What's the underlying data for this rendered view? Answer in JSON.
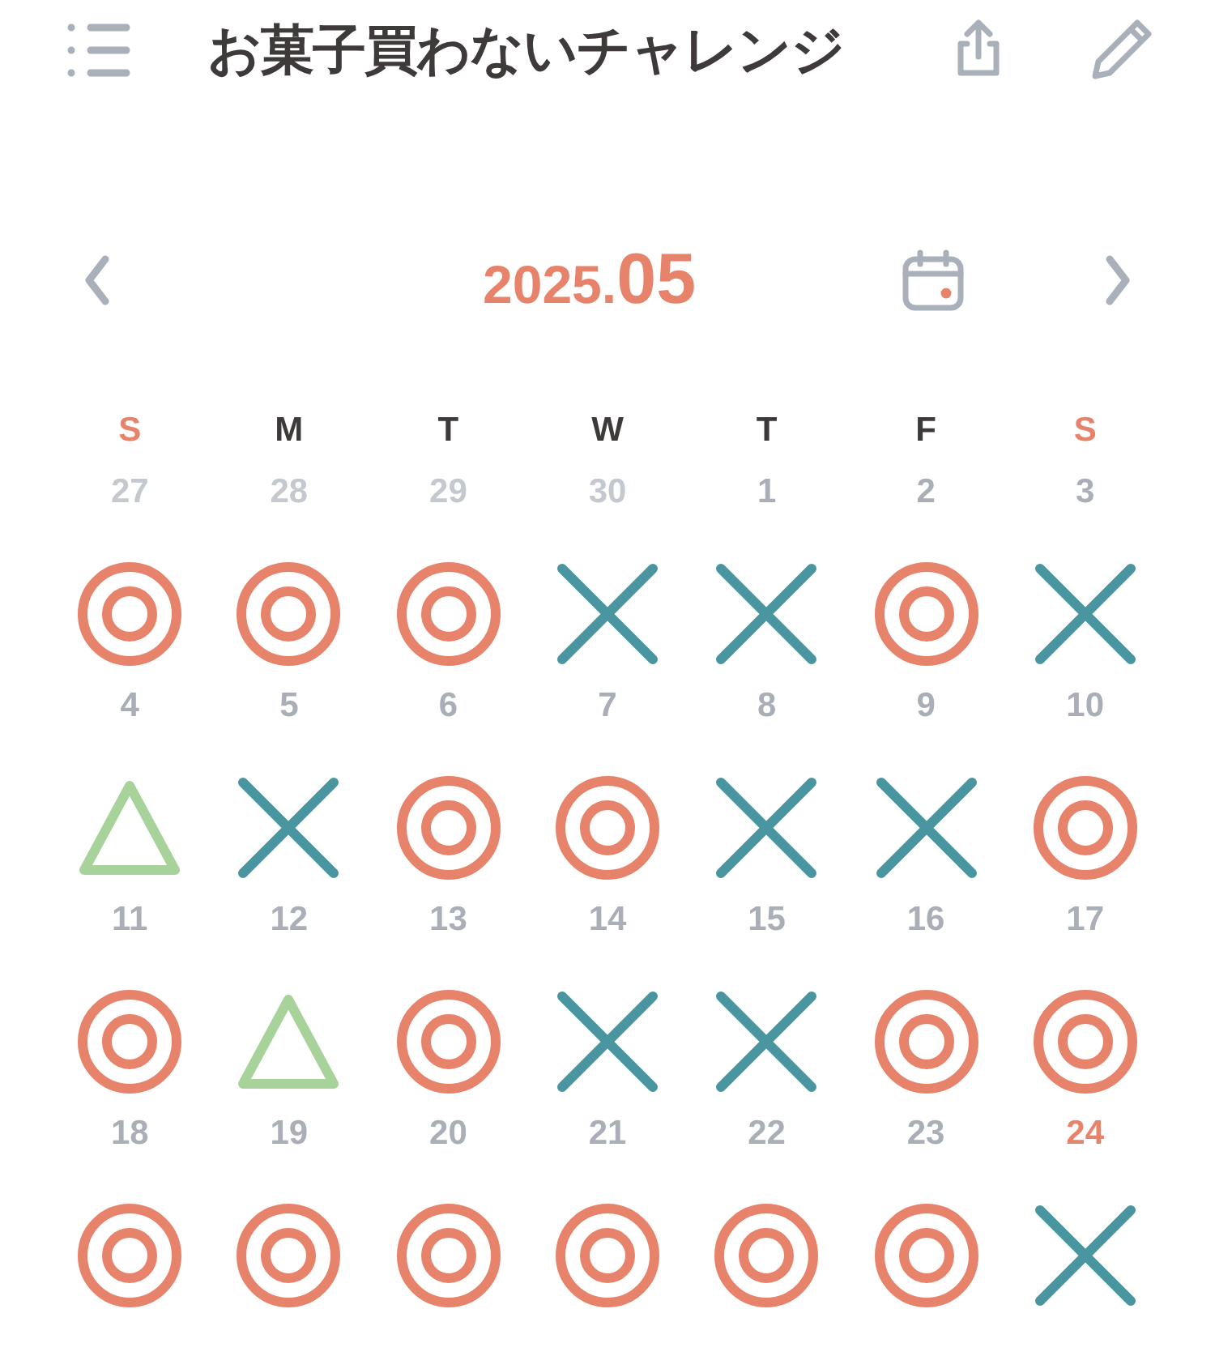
{
  "header": {
    "title": "お菓子買わないチャレンジ"
  },
  "month_nav": {
    "year": "2025.",
    "month": "05"
  },
  "weekdays": [
    {
      "label": "S",
      "color": "#e8836b"
    },
    {
      "label": "M",
      "color": "#3f3a3a"
    },
    {
      "label": "T",
      "color": "#3f3a3a"
    },
    {
      "label": "W",
      "color": "#3f3a3a"
    },
    {
      "label": "T",
      "color": "#3f3a3a"
    },
    {
      "label": "F",
      "color": "#3f3a3a"
    },
    {
      "label": "S",
      "color": "#e8836b"
    }
  ],
  "days": [
    {
      "day": "27",
      "outside": true,
      "today": false,
      "kind": "double_circle"
    },
    {
      "day": "28",
      "outside": true,
      "today": false,
      "kind": "double_circle"
    },
    {
      "day": "29",
      "outside": true,
      "today": false,
      "kind": "double_circle"
    },
    {
      "day": "30",
      "outside": true,
      "today": false,
      "kind": "cross"
    },
    {
      "day": "1",
      "outside": false,
      "today": false,
      "kind": "cross"
    },
    {
      "day": "2",
      "outside": false,
      "today": false,
      "kind": "double_circle"
    },
    {
      "day": "3",
      "outside": false,
      "today": false,
      "kind": "cross"
    },
    {
      "day": "4",
      "outside": false,
      "today": false,
      "kind": "triangle"
    },
    {
      "day": "5",
      "outside": false,
      "today": false,
      "kind": "cross"
    },
    {
      "day": "6",
      "outside": false,
      "today": false,
      "kind": "double_circle"
    },
    {
      "day": "7",
      "outside": false,
      "today": false,
      "kind": "double_circle"
    },
    {
      "day": "8",
      "outside": false,
      "today": false,
      "kind": "cross"
    },
    {
      "day": "9",
      "outside": false,
      "today": false,
      "kind": "cross"
    },
    {
      "day": "10",
      "outside": false,
      "today": false,
      "kind": "double_circle"
    },
    {
      "day": "11",
      "outside": false,
      "today": false,
      "kind": "double_circle"
    },
    {
      "day": "12",
      "outside": false,
      "today": false,
      "kind": "triangle"
    },
    {
      "day": "13",
      "outside": false,
      "today": false,
      "kind": "double_circle"
    },
    {
      "day": "14",
      "outside": false,
      "today": false,
      "kind": "cross"
    },
    {
      "day": "15",
      "outside": false,
      "today": false,
      "kind": "cross"
    },
    {
      "day": "16",
      "outside": false,
      "today": false,
      "kind": "double_circle"
    },
    {
      "day": "17",
      "outside": false,
      "today": false,
      "kind": "double_circle"
    },
    {
      "day": "18",
      "outside": false,
      "today": false,
      "kind": "double_circle"
    },
    {
      "day": "19",
      "outside": false,
      "today": false,
      "kind": "double_circle"
    },
    {
      "day": "20",
      "outside": false,
      "today": false,
      "kind": "double_circle"
    },
    {
      "day": "21",
      "outside": false,
      "today": false,
      "kind": "double_circle"
    },
    {
      "day": "22",
      "outside": false,
      "today": false,
      "kind": "double_circle"
    },
    {
      "day": "23",
      "outside": false,
      "today": false,
      "kind": "double_circle"
    },
    {
      "day": "24",
      "outside": false,
      "today": true,
      "kind": "cross"
    }
  ]
}
